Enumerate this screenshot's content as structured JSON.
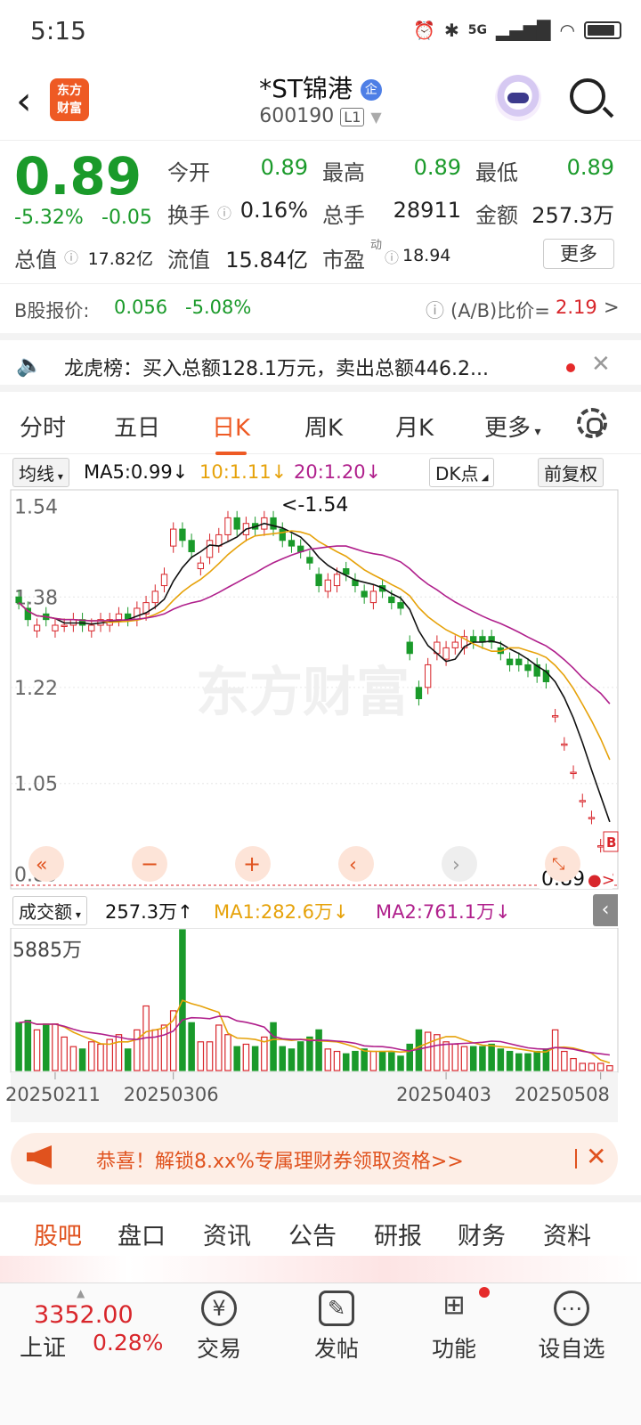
{
  "status_bar": {
    "time": "5:15",
    "icons": [
      "alarm-icon",
      "bluetooth-icon",
      "5g-signal-icon",
      "wifi-icon",
      "battery-icon"
    ],
    "network": "5G"
  },
  "header": {
    "back": "‹",
    "logo_line1": "东方",
    "logo_line2": "财富",
    "name": "*ST锦港",
    "badge": "企",
    "code": "600190",
    "level": "L1"
  },
  "quote": {
    "price": "0.89",
    "change_pct": "-5.32%",
    "change": "-0.05",
    "open_label": "今开",
    "open": "0.89",
    "high_label": "最高",
    "high": "0.89",
    "low_label": "最低",
    "low": "0.89",
    "turnover_label": "换手",
    "turnover": "0.16%",
    "volume_label": "总手",
    "volume": "28911",
    "amount_label": "金额",
    "amount": "257.3万",
    "mktcap_label": "总值",
    "mktcap": "17.82亿",
    "float_label": "流值",
    "float": "15.84亿",
    "pe_label": "市盈",
    "pe_sup": "动",
    "pe": "18.94",
    "more": "更多"
  },
  "b_share": {
    "label": "B股报价:",
    "price": "0.056",
    "pct": "-5.08%",
    "ratio_label": "(A/B)比价=",
    "ratio": "2.19",
    "arrow": ">"
  },
  "notice": {
    "text": "龙虎榜：买入总额128.1万元，卖出总额446.2..."
  },
  "tabs": [
    "分时",
    "五日",
    "日K",
    "周K",
    "月K",
    "更多"
  ],
  "ma_legend": {
    "selector": "均线",
    "ma5": "MA5:0.99↓",
    "ma10": "10:1.11↓",
    "ma20": "20:1.20↓",
    "dk": "DK点",
    "adj": "前复权"
  },
  "chart_data": {
    "type": "candlestick",
    "y_ticks": [
      "1.54",
      "1.38",
      "1.22",
      "1.05",
      "0.89"
    ],
    "max_label": "<-1.54",
    "last_label": "0.89",
    "ma5_color": "#111111",
    "ma10_color": "#e6a20a",
    "ma20_color": "#b0208c",
    "up_color": "#d8262b",
    "down_color": "#1a9a2a",
    "close": [
      1.37,
      1.34,
      1.33,
      1.34,
      1.33,
      1.33,
      1.34,
      1.33,
      1.33,
      1.34,
      1.34,
      1.35,
      1.34,
      1.36,
      1.37,
      1.39,
      1.42,
      1.5,
      1.48,
      1.46,
      1.44,
      1.48,
      1.49,
      1.52,
      1.5,
      1.51,
      1.5,
      1.52,
      1.5,
      1.48,
      1.47,
      1.46,
      1.44,
      1.4,
      1.41,
      1.42,
      1.42,
      1.4,
      1.38,
      1.39,
      1.39,
      1.37,
      1.36,
      1.28,
      1.2,
      1.26,
      1.3,
      1.29,
      1.3,
      1.31,
      1.3,
      1.3,
      1.3,
      1.28,
      1.26,
      1.26,
      1.25,
      1.24,
      1.23,
      1.17,
      1.12,
      1.07,
      1.02,
      0.99,
      0.94,
      0.89
    ],
    "open": [
      1.38,
      1.36,
      1.32,
      1.35,
      1.32,
      1.33,
      1.33,
      1.34,
      1.32,
      1.33,
      1.33,
      1.34,
      1.35,
      1.34,
      1.35,
      1.37,
      1.4,
      1.47,
      1.5,
      1.48,
      1.43,
      1.45,
      1.47,
      1.49,
      1.52,
      1.49,
      1.51,
      1.5,
      1.52,
      1.5,
      1.48,
      1.47,
      1.45,
      1.42,
      1.39,
      1.4,
      1.43,
      1.41,
      1.39,
      1.37,
      1.4,
      1.38,
      1.37,
      1.3,
      1.22,
      1.22,
      1.28,
      1.27,
      1.29,
      1.29,
      1.31,
      1.31,
      1.31,
      1.29,
      1.27,
      1.27,
      1.26,
      1.26,
      1.25,
      1.17,
      1.12,
      1.07,
      1.02,
      0.99,
      0.94,
      0.89
    ],
    "volume_max_label": "5885万",
    "volume": [
      2000,
      2100,
      1700,
      1950,
      1950,
      1400,
      1000,
      900,
      1200,
      1100,
      1300,
      1500,
      900,
      1700,
      2700,
      1700,
      1900,
      2500,
      5885,
      2000,
      1200,
      1200,
      1900,
      1500,
      1000,
      1100,
      1000,
      1400,
      2000,
      1000,
      900,
      1200,
      1400,
      1700,
      900,
      800,
      700,
      800,
      900,
      800,
      800,
      750,
      600,
      1100,
      1700,
      1600,
      1500,
      1200,
      1100,
      1000,
      1000,
      1000,
      1100,
      900,
      800,
      700,
      700,
      800,
      900,
      1700,
      800,
      500,
      300,
      300,
      300,
      200
    ],
    "dates": [
      "20250211",
      "20250306",
      "20250403",
      "20250508"
    ]
  },
  "vol_legend": {
    "selector": "成交额",
    "amount": "257.3万↑",
    "ma1": "MA1:282.6万↓",
    "ma2": "MA2:761.1万↓"
  },
  "banner": {
    "text": "恭喜！解锁8.xx%专属理财券领取资格>>"
  },
  "subtabs": [
    "股吧",
    "盘口",
    "资讯",
    "公告",
    "研报",
    "财务",
    "资料"
  ],
  "bottom_nav": {
    "index_value": "3352.00",
    "index_name": "上证",
    "index_pct": "0.28%",
    "items": [
      {
        "label": "交易",
        "icon": "yen-icon"
      },
      {
        "label": "发帖",
        "icon": "edit-icon"
      },
      {
        "label": "功能",
        "icon": "grid-icon"
      },
      {
        "label": "设自选",
        "icon": "more-icon"
      }
    ]
  },
  "watermark": "东方财富"
}
